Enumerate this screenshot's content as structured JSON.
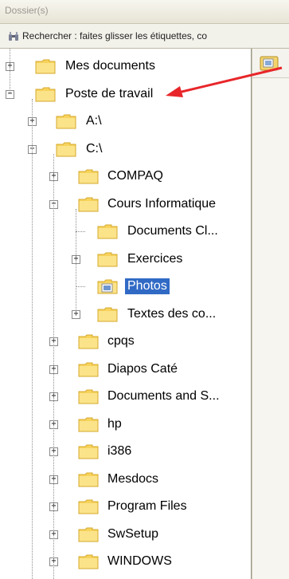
{
  "window": {
    "title": "Dossier(s)"
  },
  "search": {
    "hint": "Rechercher : faites glisser les étiquettes, co",
    "icon": "binoculars-icon"
  },
  "tree": {
    "items": [
      {
        "label": "Mes documents",
        "expander": "+",
        "level": 0
      },
      {
        "label": "Poste de travail",
        "expander": "−",
        "level": 0
      },
      {
        "label": "A:\\",
        "expander": "+",
        "level": 1
      },
      {
        "label": "C:\\",
        "expander": "−",
        "level": 1
      },
      {
        "label": "COMPAQ",
        "expander": "+",
        "level": 2
      },
      {
        "label": "Cours Informatique",
        "expander": "−",
        "level": 2
      },
      {
        "label": "Documents Cl...",
        "expander": "",
        "level": 3
      },
      {
        "label": "Exercices",
        "expander": "+",
        "level": 3
      },
      {
        "label": "Photos",
        "expander": "",
        "level": 3,
        "selected": true
      },
      {
        "label": "Textes des co...",
        "expander": "+",
        "level": 3
      },
      {
        "label": "cpqs",
        "expander": "+",
        "level": 2
      },
      {
        "label": "Diapos Caté",
        "expander": "+",
        "level": 2
      },
      {
        "label": "Documents and S...",
        "expander": "+",
        "level": 2
      },
      {
        "label": "hp",
        "expander": "+",
        "level": 2
      },
      {
        "label": "i386",
        "expander": "+",
        "level": 2
      },
      {
        "label": "Mesdocs",
        "expander": "+",
        "level": 2
      },
      {
        "label": "Program Files",
        "expander": "+",
        "level": 2
      },
      {
        "label": "SwSetup",
        "expander": "+",
        "level": 2
      },
      {
        "label": "WINDOWS",
        "expander": "+",
        "level": 2
      }
    ]
  },
  "colors": {
    "selection": "#316ac5",
    "folder": "#f7d35c",
    "arrow": "#e8262a"
  }
}
